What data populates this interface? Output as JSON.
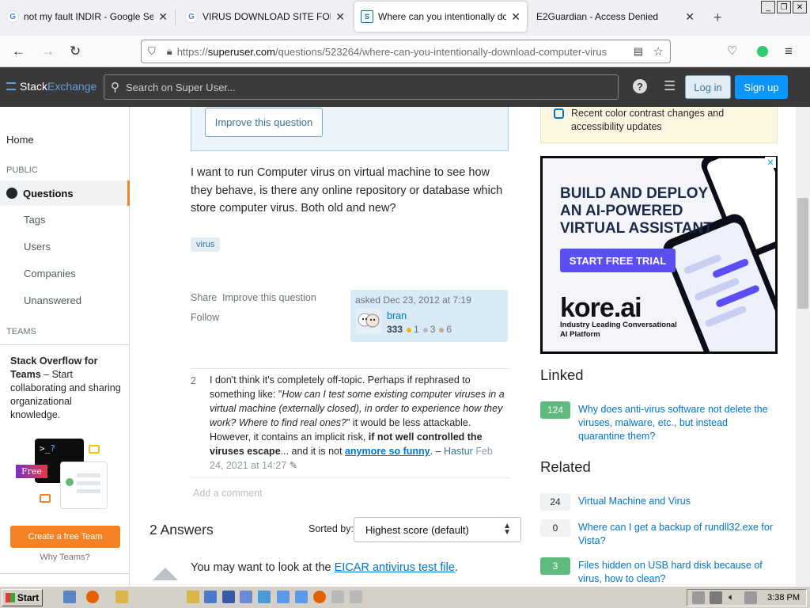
{
  "browser": {
    "tabs": [
      {
        "title": "not my fault INDIR - Google Search",
        "favicon": "google-icon"
      },
      {
        "title": "VIRUS DOWNLOAD SITE FOR TESTING",
        "favicon": "google-icon"
      },
      {
        "title": "Where can you intentionally download",
        "favicon": "superuser-icon",
        "active": true
      },
      {
        "title": "E2Guardian - Access Denied",
        "favicon": ""
      }
    ],
    "new_tab": "+",
    "url": {
      "prefix": "https://",
      "host": "superuser.com",
      "path": "/questions/523264/where-can-you-intentionally-download-computer-virus"
    }
  },
  "header": {
    "logo_a": "Stack",
    "logo_b": "Exchange",
    "search_placeholder": "Search on Super User...",
    "login": "Log in",
    "signup": "Sign up"
  },
  "sidebar": {
    "home": "Home",
    "public_label": "PUBLIC",
    "questions": "Questions",
    "tags": "Tags",
    "users": "Users",
    "companies": "Companies",
    "unanswered": "Unanswered",
    "teams_label": "TEAMS",
    "teams_title": "Stack Overflow for Teams",
    "teams_text": " – Start collaborating and sharing organizational knowledge.",
    "free_badge": "Free",
    "teams_cta": "Create a free Team",
    "why_teams": "Why Teams?"
  },
  "question": {
    "improve_btn": "Improve this question",
    "body": "I want to run Computer virus on virtual machine to see how they behave, is there any online repository or database which store computer virus. Both old and new?",
    "tag": "virus",
    "share": "Share",
    "improve": "Improve this question",
    "follow": "Follow",
    "asked": "asked Dec 23, 2012 at 7:19",
    "user": {
      "name": "bran",
      "rep": "333",
      "gold": "1",
      "silver": "3",
      "bronze": "6"
    }
  },
  "comment": {
    "score": "2",
    "t1": "I don't think it's completely off-topic. Perhaps if rephrased to something like: \"",
    "italic": "How can I test some existing computer viruses in a virtual machine (externally closed), in order to experience how they work? Where to find real ones?",
    "t2": "\" it would be less attackable. However, it contains an implicit risk, ",
    "bold": "if not well controlled the viruses escape",
    "t3": "... and it is not ",
    "link": "anymore so funny",
    "t4": ". – ",
    "user": "Hastur",
    "date": "Feb 24, 2021 at 14:27"
  },
  "add_comment": "Add a comment",
  "answers": {
    "heading": "2 Answers",
    "sorted_by": "Sorted by:",
    "sort_value": "Highest score (default)",
    "first_text": "You may want to look at the ",
    "first_link": "EICAR antivirus test file",
    "first_end": "."
  },
  "featured": {
    "text": "Recent color contrast changes and accessibility updates"
  },
  "ad": {
    "headline": "BUILD AND DEPLOY AN AI-POWERED VIRTUAL ASSISTANT",
    "cta": "START FREE TRIAL",
    "brand": "kore.ai",
    "tagline": "Industry Leading Conversational AI Platform",
    "close": "✕"
  },
  "linked": {
    "heading": "Linked",
    "items": [
      {
        "count": "124",
        "title": "Why does anti-virus software not delete the viruses, malware, etc., but instead quarantine them?",
        "answered": true
      }
    ]
  },
  "related": {
    "heading": "Related",
    "items": [
      {
        "count": "24",
        "title": "Virtual Machine and Virus",
        "answered": false
      },
      {
        "count": "0",
        "title": "Where can I get a backup of rundll32.exe for Vista?",
        "answered": false
      },
      {
        "count": "3",
        "title": "Files hidden on USB hard disk because of virus, how to clean?",
        "answered": true
      }
    ]
  },
  "taskbar": {
    "start": "Start",
    "clock": "3:38 PM"
  },
  "colors": {
    "accent": "#f48225",
    "link": "#0074cc",
    "answered": "#5eba7d",
    "header": "#393939"
  }
}
